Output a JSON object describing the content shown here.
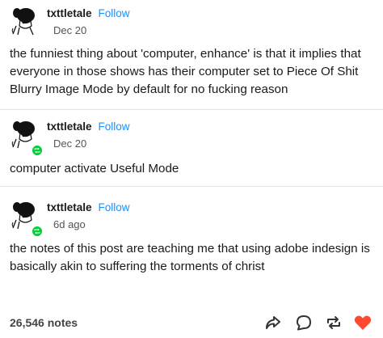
{
  "posts": [
    {
      "username": "txttletale",
      "follow_label": "Follow",
      "date": "Dec 20",
      "text": "the funniest thing about 'computer, enhance' is that it implies that everyone in those shows has their computer set to Piece Of Shit Blurry Image Mode by default for no fucking reason",
      "reblog": false
    },
    {
      "username": "txttletale",
      "follow_label": "Follow",
      "date": "Dec 20",
      "text": "computer activate Useful Mode",
      "reblog": true
    },
    {
      "username": "txttletale",
      "follow_label": "Follow",
      "date": "6d ago",
      "text": "the notes of this post are teaching me that using adobe indesign is basically akin to suffering the torments of christ",
      "reblog": true
    }
  ],
  "footer": {
    "notes": "26,546 notes",
    "icons": [
      "share-icon",
      "reply-icon",
      "reblog-icon",
      "like-heart-icon"
    ]
  },
  "colors": {
    "follow": "#1e8fff",
    "reblog_badge": "#00cf35",
    "heart": "#ff4930"
  }
}
